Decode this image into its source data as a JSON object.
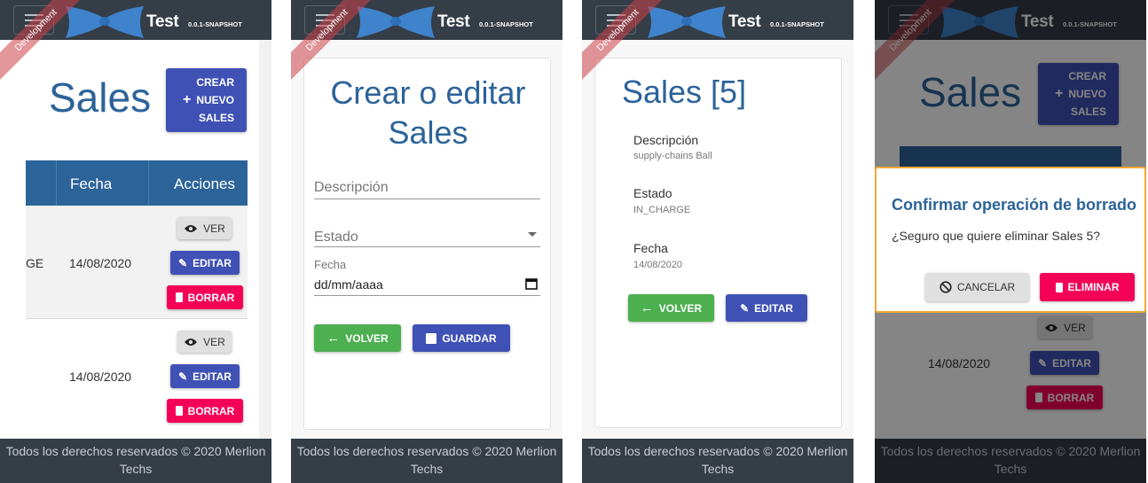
{
  "app": {
    "brand": "Test",
    "version": "0.0.1-SNAPSHOT",
    "ribbon": "Development"
  },
  "footer": {
    "line1": "Todos los derechos reservados © 2020 Merlion",
    "line2": "Techs"
  },
  "list": {
    "title": "Sales",
    "create_button": {
      "line1": "CREAR",
      "line2": "NUEVO",
      "line3": "SALES"
    },
    "columns": [
      "Fecha",
      "Acciones"
    ],
    "rows": [
      {
        "estado_fragment": "GE",
        "fecha": "14/08/2020"
      },
      {
        "estado_fragment": "",
        "fecha": "14/08/2020"
      }
    ],
    "actions": {
      "view": "VER",
      "edit": "EDITAR",
      "delete": "BORRAR"
    }
  },
  "form": {
    "title_line1": "Crear o editar",
    "title_line2": "Sales",
    "descripcion_placeholder": "Descripción",
    "estado_placeholder": "Estado",
    "fecha_label": "Fecha",
    "fecha_value": "dd/mm/aaaa",
    "back_button": "VOLVER",
    "save_button": "GUARDAR"
  },
  "detail": {
    "title": "Sales [5]",
    "fields": [
      {
        "label": "Descripción",
        "value": "supply-chains Ball"
      },
      {
        "label": "Estado",
        "value": "IN_CHARGE"
      },
      {
        "label": "Fecha",
        "value": "14/08/2020"
      }
    ],
    "back_button": "VOLVER",
    "edit_button": "EDITAR"
  },
  "dialog": {
    "title": "Confirmar operación de borrado",
    "message": "¿Seguro que quiere eliminar Sales 5?",
    "cancel_button": "CANCELAR",
    "delete_button": "ELIMINAR"
  },
  "colors": {
    "navbar": "#353d47",
    "title": "#2c6399",
    "primary": "#3f51b5",
    "success": "#4caf50",
    "danger": "#f50057",
    "dialog_border": "#f0a830"
  }
}
